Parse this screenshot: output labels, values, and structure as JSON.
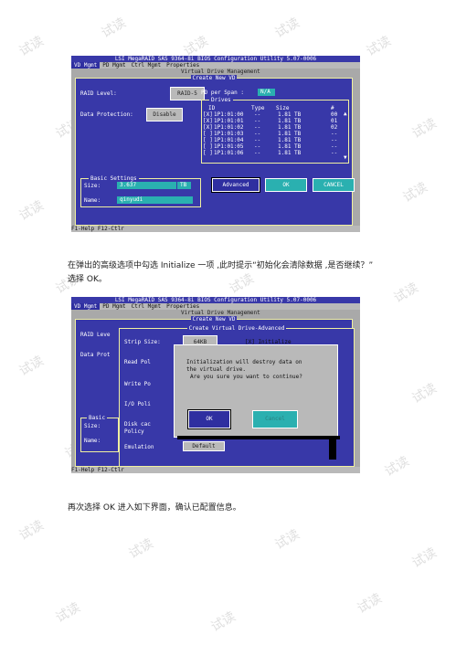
{
  "screen1": {
    "title": "LSI MegaRAID SAS 9364-8i BIOS Configuration Utility 5.07-0006",
    "menu": [
      "VD Mgmt",
      "PD Mgmt",
      "Ctrl Mgmt",
      "Properties"
    ],
    "vd_management_title": "Virtual Drive Management",
    "create_new_vd_title": "Create New VD",
    "raid_level_label": "RAID Level:",
    "raid_level_value": "RAID-5",
    "data_protection_label": "Data Protection:",
    "data_protection_value": "Disable",
    "pd_per_span_label": "PD per Span :",
    "pd_per_span_value": "N/A",
    "drives_title": "Drives",
    "drives_headers": [
      "ID",
      "Type",
      "Size",
      "#"
    ],
    "drives": [
      {
        "sel": "[X]",
        "id": "1P1:01:00",
        "type": "--",
        "size": "1.81 TB",
        "num": "00"
      },
      {
        "sel": "[X]",
        "id": "1P1:01:01",
        "type": "--",
        "size": "1.81 TB",
        "num": "01"
      },
      {
        "sel": "[X]",
        "id": "1P1:01:02",
        "type": "--",
        "size": "1.81 TB",
        "num": "02"
      },
      {
        "sel": "[ ]",
        "id": "1P1:01:03",
        "type": "--",
        "size": "1.81 TB",
        "num": "--"
      },
      {
        "sel": "[ ]",
        "id": "1P1:01:04",
        "type": "--",
        "size": "1.81 TB",
        "num": "--"
      },
      {
        "sel": "[ ]",
        "id": "1P1:01:05",
        "type": "--",
        "size": "1.81 TB",
        "num": "--"
      },
      {
        "sel": "[ ]",
        "id": "1P1:01:06",
        "type": "--",
        "size": "1.81 TB",
        "num": "--"
      }
    ],
    "basic_settings_title": "Basic Settings",
    "size_label": "Size:",
    "size_value": "3.637",
    "size_unit": "TB",
    "name_label": "Name:",
    "name_value": "qinyudi",
    "advanced_button": "Advanced",
    "ok_button": "OK",
    "cancel_button": "CANCEL",
    "status_bar": "F1-Help F12-Ctlr"
  },
  "paragraph1_line1": "在弹出的高级选项中勾选 Initialize 一项 ,此时提示“初始化会清除数据 ,是否继续？”",
  "paragraph1_line2": "选择 OK。",
  "screen2": {
    "title": "LSI MegaRAID SAS 9364-8i BIOS Configuration Utility 5.07-0006",
    "menu": [
      "VD Mgmt",
      "PD Mgmt",
      "Ctrl Mgmt",
      "Properties"
    ],
    "vd_management_title": "Virtual Drive Management",
    "create_new_vd_title": "Create New VD",
    "create_advanced_title": "Create Virtual Drive-Advanced",
    "raid_level_label_partial": "RAID Leve",
    "data_prot_label_partial": "Data Prot",
    "basic_label_partial": "Basic",
    "size_label": "Size:",
    "name_label": "Name:",
    "strip_size_label": "Strip Size:",
    "strip_size_value": "64KB",
    "initialize_option": "[X] Initialize",
    "read_policy_partial": "Read Pol",
    "write_policy_partial": "Write Po",
    "io_policy_partial": "I/O Poli",
    "disk_cache_label": "Disk cac",
    "policy_label": "Policy",
    "emulation_label": "Emulation",
    "emulation_value": "Default",
    "confirm_line1": "Initialization will destroy data on",
    "confirm_line2": "the virtual drive.",
    "confirm_line3": "Are you sure you want to continue?",
    "confirm_ok": "OK",
    "confirm_cancel": "Cancel",
    "status_bar": "F1-Help F12-Ctlr"
  },
  "paragraph2": "再次选择 OK 进入如下界面，确认已配置信息。",
  "watermark_text": "试读"
}
